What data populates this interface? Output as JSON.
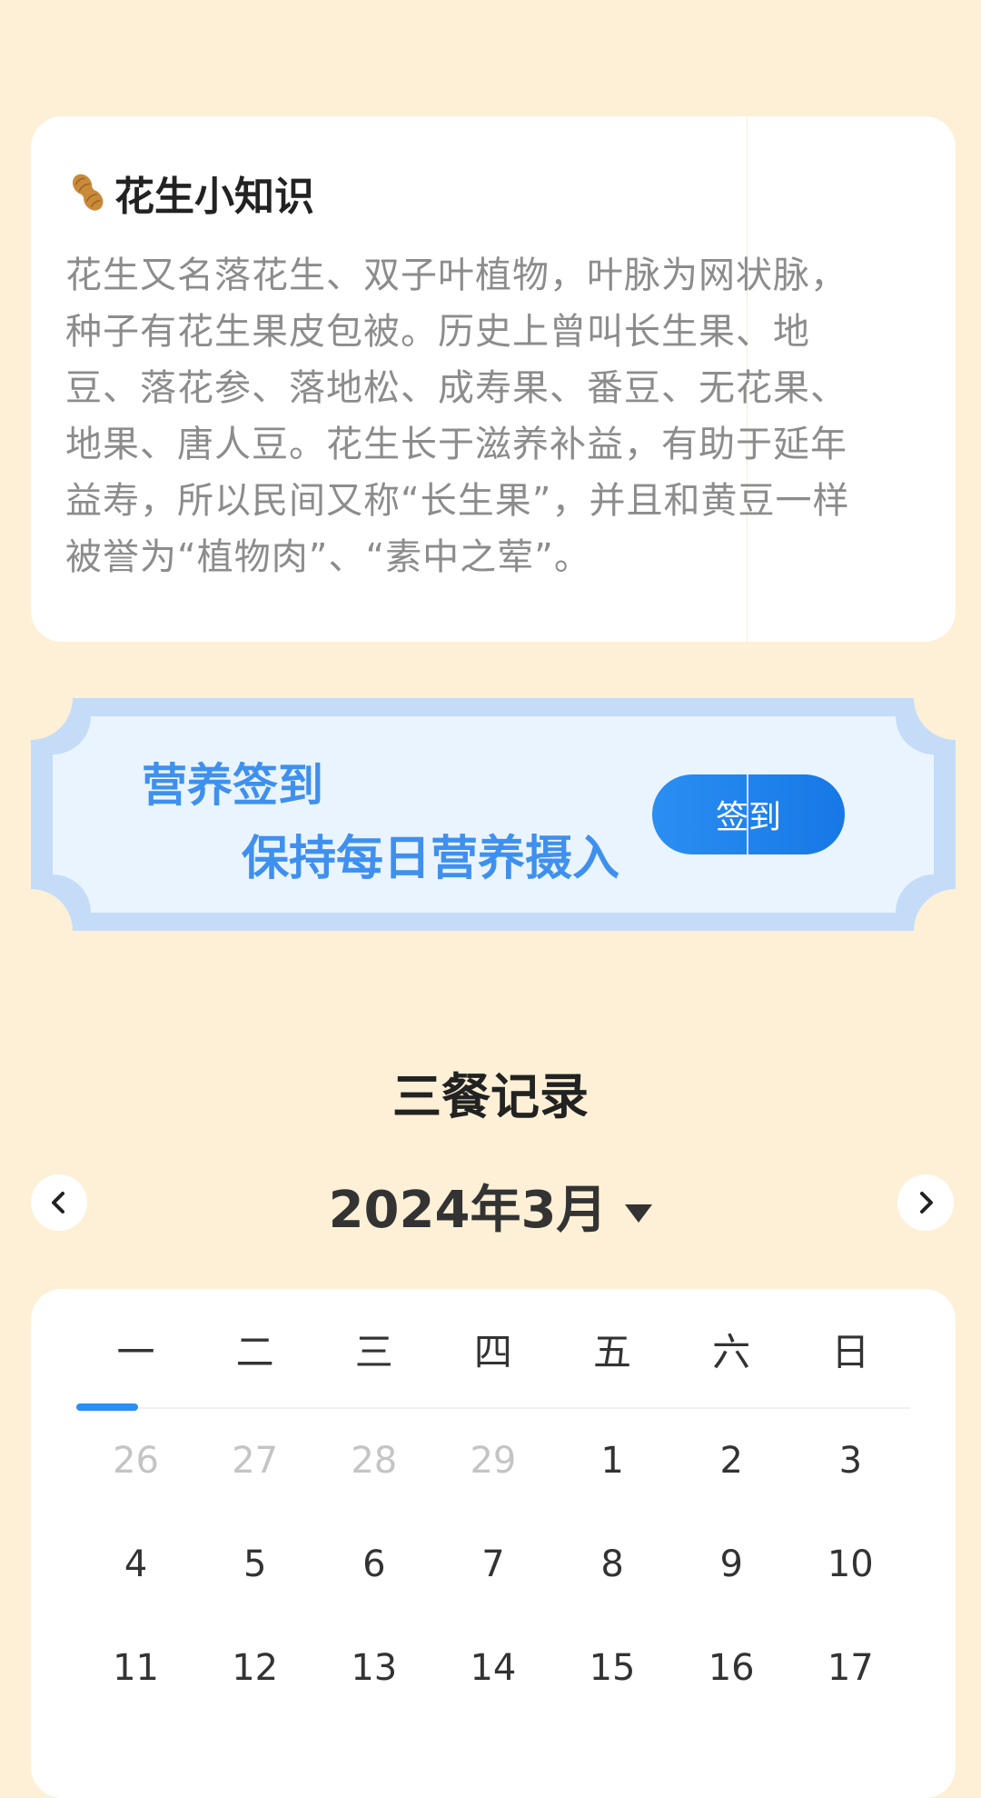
{
  "knowledge": {
    "title": "花生小知识",
    "lines": [
      "花生又名落花生、双子叶植物，叶脉为网状脉，",
      "种子有花生果皮包被。历史上曾叫长生果、地",
      "豆、落花参、落地松、成寿果、番豆、无花果、",
      "地果、唐人豆。花生长于滋养补益，有助于延年",
      "益寿，所以民间又称“长生果”，并且和黄豆一样",
      "被誉为“植物肉”、“素中之荤”。"
    ]
  },
  "banner": {
    "line1": "营养签到",
    "line2": "保持每日营养摄入",
    "button": "签到"
  },
  "meals": {
    "title": "三餐记录",
    "month": "2024年3月",
    "prev_icon": "chevron-left-icon",
    "next_icon": "chevron-right-icon"
  },
  "calendar": {
    "weekdays": [
      "一",
      "二",
      "三",
      "四",
      "五",
      "六",
      "日"
    ],
    "weeks": [
      [
        {
          "d": "26",
          "m": true
        },
        {
          "d": "27",
          "m": true
        },
        {
          "d": "28",
          "m": true
        },
        {
          "d": "29",
          "m": true
        },
        {
          "d": "1"
        },
        {
          "d": "2"
        },
        {
          "d": "3"
        }
      ],
      [
        {
          "d": "4"
        },
        {
          "d": "5"
        },
        {
          "d": "6"
        },
        {
          "d": "7"
        },
        {
          "d": "8"
        },
        {
          "d": "9"
        },
        {
          "d": "10"
        }
      ],
      [
        {
          "d": "11"
        },
        {
          "d": "12"
        },
        {
          "d": "13"
        },
        {
          "d": "14"
        },
        {
          "d": "15"
        },
        {
          "d": "16"
        },
        {
          "d": "17"
        }
      ]
    ],
    "accent": "#2a8ef2"
  }
}
